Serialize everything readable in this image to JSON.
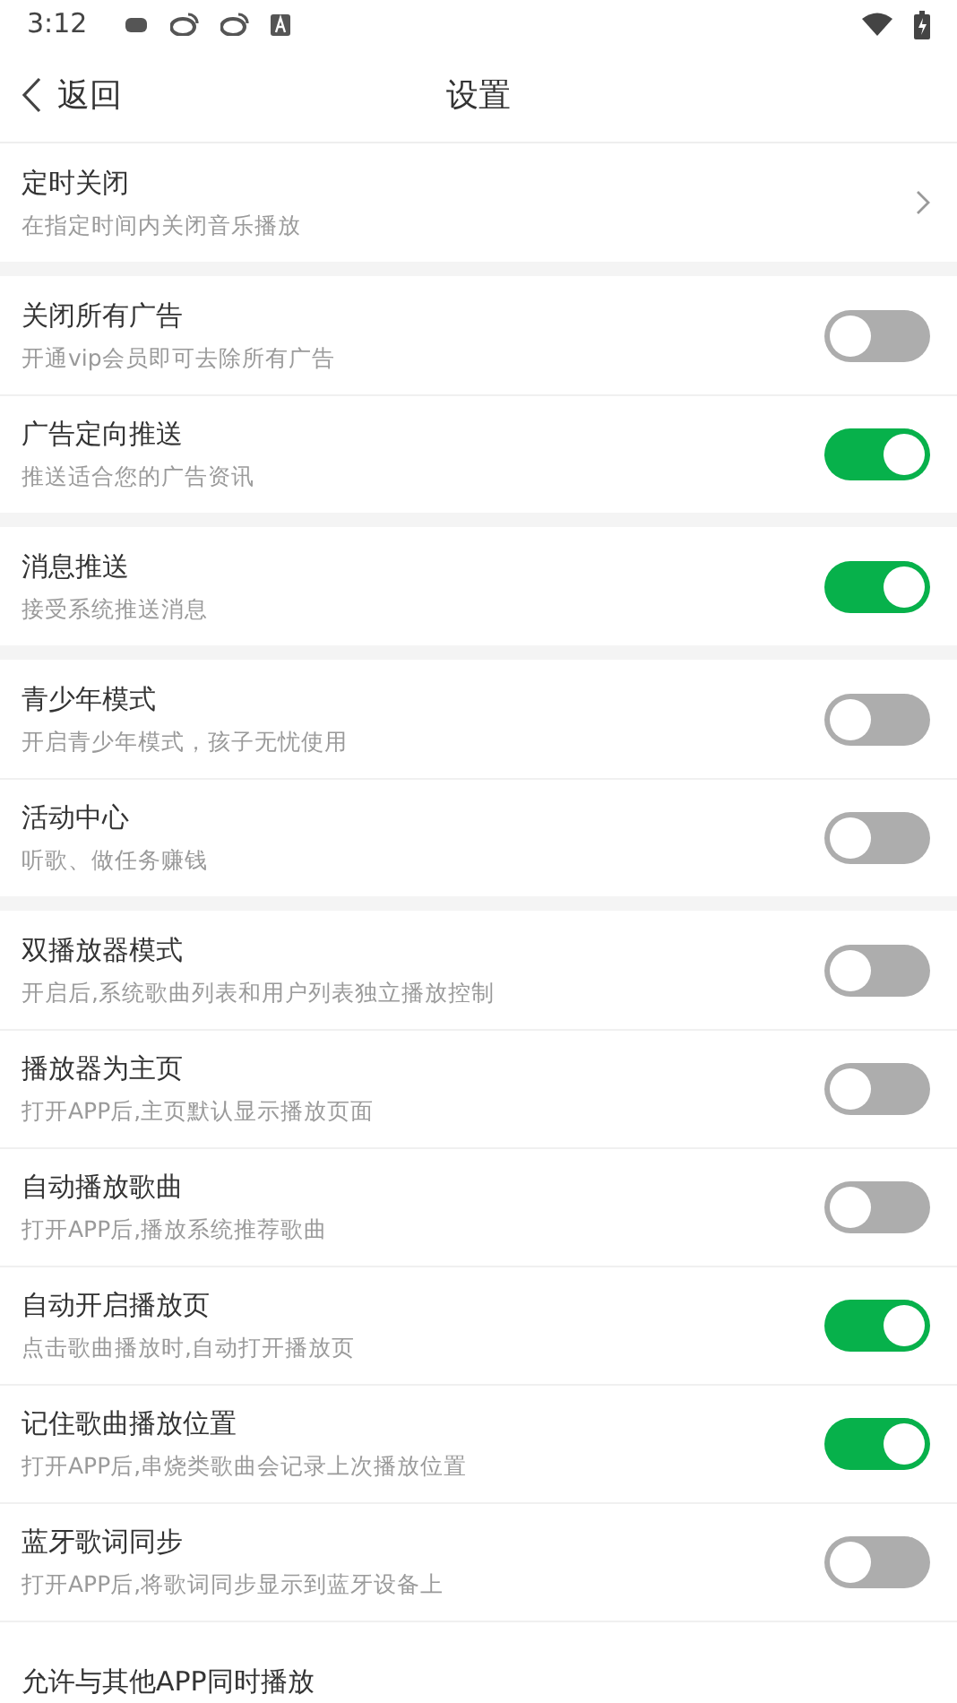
{
  "status_bar": {
    "time": "3:12"
  },
  "header": {
    "back": "返回",
    "title": "设置"
  },
  "groups": [
    {
      "items": [
        {
          "kind": "arrow",
          "title": "定时关闭",
          "subtitle": "在指定时间内关闭音乐播放"
        }
      ]
    },
    {
      "items": [
        {
          "kind": "toggle",
          "title": "关闭所有广告",
          "subtitle": "开通vip会员即可去除所有广告",
          "on": false
        },
        {
          "kind": "toggle",
          "title": "广告定向推送",
          "subtitle": "推送适合您的广告资讯",
          "on": true
        }
      ]
    },
    {
      "items": [
        {
          "kind": "toggle",
          "title": "消息推送",
          "subtitle": "接受系统推送消息",
          "on": true
        }
      ]
    },
    {
      "items": [
        {
          "kind": "toggle",
          "title": "青少年模式",
          "subtitle": "开启青少年模式，孩子无忧使用",
          "on": false
        },
        {
          "kind": "toggle",
          "title": "活动中心",
          "subtitle": "听歌、做任务赚钱",
          "on": false
        }
      ]
    },
    {
      "items": [
        {
          "kind": "toggle",
          "title": "双播放器模式",
          "subtitle": "开启后,系统歌曲列表和用户列表独立播放控制",
          "on": false
        },
        {
          "kind": "toggle",
          "title": "播放器为主页",
          "subtitle": "打开APP后,主页默认显示播放页面",
          "on": false
        },
        {
          "kind": "toggle",
          "title": "自动播放歌曲",
          "subtitle": "打开APP后,播放系统推荐歌曲",
          "on": false
        },
        {
          "kind": "toggle",
          "title": "自动开启播放页",
          "subtitle": "点击歌曲播放时,自动打开播放页",
          "on": true
        },
        {
          "kind": "toggle",
          "title": "记住歌曲播放位置",
          "subtitle": "打开APP后,串烧类歌曲会记录上次播放位置",
          "on": true
        },
        {
          "kind": "toggle",
          "title": "蓝牙歌词同步",
          "subtitle": "打开APP后,将歌词同步显示到蓝牙设备上",
          "on": false
        },
        {
          "kind": "label",
          "title": "允许与其他APP同时播放"
        }
      ]
    }
  ]
}
